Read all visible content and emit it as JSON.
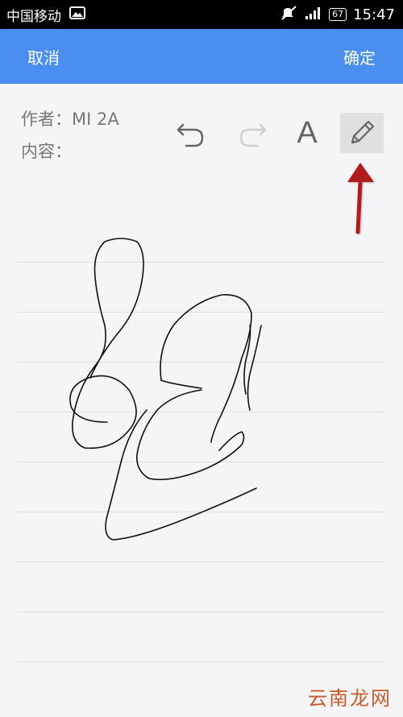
{
  "status_bar": {
    "carrier": "中国移动",
    "battery": "67",
    "time": "15:47",
    "icons": [
      "image-icon",
      "mute-icon",
      "signal-icon",
      "battery-icon"
    ]
  },
  "title_bar": {
    "cancel_label": "取消",
    "confirm_label": "确定",
    "color": "#4a8ff0"
  },
  "note": {
    "author_label": "作者：",
    "author_value": "MI 2A",
    "content_label": "内容："
  },
  "toolbar": {
    "undo_icon": "undo-icon",
    "redo_icon": "redo-icon",
    "font_label": "A",
    "pen_icon": "pencil-icon",
    "selected_tool": "pencil"
  },
  "annotation": {
    "arrow_color": "#b01c1c"
  },
  "watermark": {
    "text": "云南龙网"
  }
}
